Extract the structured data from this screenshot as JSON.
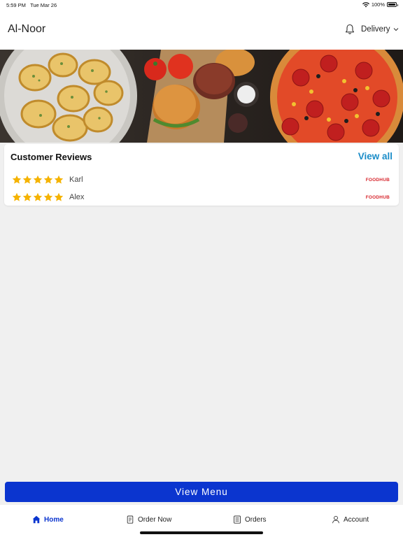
{
  "status": {
    "time": "5:59 PM",
    "date": "Tue Mar 26",
    "battery": "100%",
    "battery_level": 1.0
  },
  "header": {
    "title": "Al-Noor",
    "order_type": "Delivery"
  },
  "banner": {
    "description_icons": [
      "garlic-bread",
      "burgers",
      "pizza"
    ]
  },
  "reviews": {
    "title": "Customer Reviews",
    "view_all": "View all",
    "items": [
      {
        "name": "Karl",
        "rating": 5,
        "source": "FOODHUB"
      },
      {
        "name": "Alex",
        "rating": 5,
        "source": "FOODHUB"
      }
    ]
  },
  "actions": {
    "view_menu": "View Menu"
  },
  "tabs": [
    {
      "label": "Home",
      "icon": "home-icon",
      "active": true
    },
    {
      "label": "Order Now",
      "icon": "order-icon",
      "active": false
    },
    {
      "label": "Orders",
      "icon": "orders-icon",
      "active": false
    },
    {
      "label": "Account",
      "icon": "account-icon",
      "active": false
    }
  ],
  "colors": {
    "primary": "#0b35cf",
    "link": "#1a8cc8",
    "star": "#f5b301",
    "brand": "#d7262d"
  }
}
